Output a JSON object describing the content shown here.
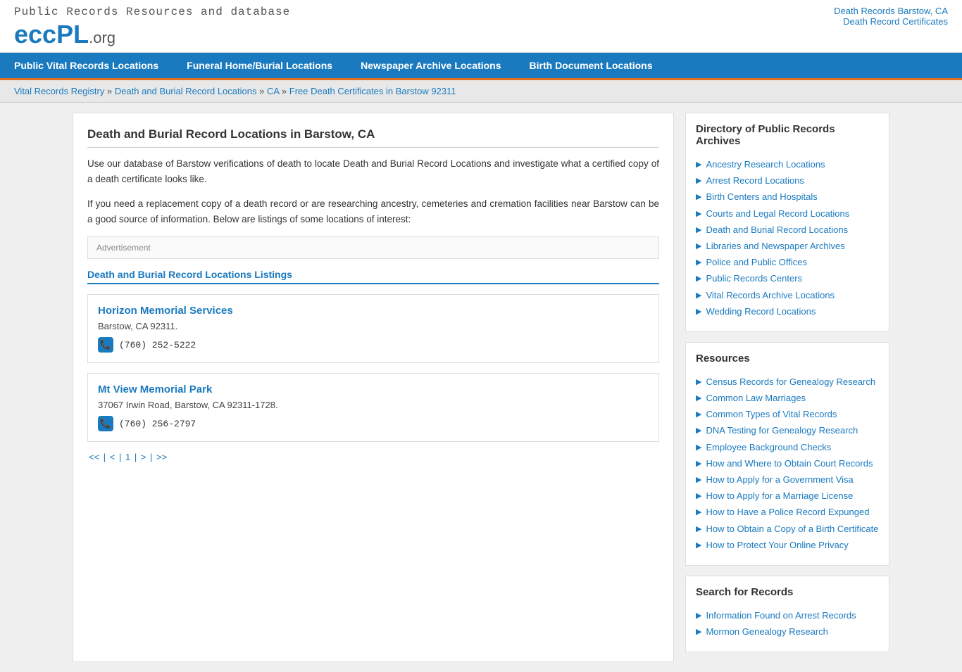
{
  "topLinks": [
    {
      "label": "Death Records Barstow, CA",
      "href": "#"
    },
    {
      "label": "Death Record Certificates",
      "href": "#"
    }
  ],
  "logo": {
    "tagline": "Public Records Resources and database",
    "eccPL": "eccPL",
    "org": ".org"
  },
  "nav": [
    {
      "label": "Public Vital Records Locations",
      "href": "#"
    },
    {
      "label": "Funeral Home/Burial Locations",
      "href": "#"
    },
    {
      "label": "Newspaper Archive Locations",
      "href": "#"
    },
    {
      "label": "Birth Document Locations",
      "href": "#"
    }
  ],
  "breadcrumb": [
    {
      "label": "Vital Records Registry",
      "href": "#"
    },
    {
      "label": "Death and Burial Record Locations",
      "href": "#"
    },
    {
      "label": "CA",
      "href": "#"
    },
    {
      "label": "Free Death Certificates in Barstow 92311",
      "href": "#"
    }
  ],
  "mainContent": {
    "title": "Death and Burial Record Locations in Barstow, CA",
    "paragraphs": [
      "Use our database of Barstow verifications of death to locate Death and Burial Record Locations and investigate what a certified copy of a death certificate looks like.",
      "If you need a replacement copy of a death record or are researching ancestry, cemeteries and cremation facilities near Barstow can be a good source of information. Below are listings of some locations of interest:"
    ],
    "adLabel": "Advertisement",
    "listingsHeading": "Death and Burial Record Locations Listings",
    "listings": [
      {
        "name": "Horizon Memorial Services",
        "address": "Barstow, CA 92311.",
        "phone": "(760) 252-5222"
      },
      {
        "name": "Mt View Memorial Park",
        "address": "37067 Irwin Road, Barstow, CA 92311-1728.",
        "phone": "(760) 256-2797"
      }
    ],
    "pagination": {
      "text": "<< | < | 1 | > | >>"
    }
  },
  "sidebar": {
    "directory": {
      "heading": "Directory of Public Records Archives",
      "items": [
        {
          "label": "Ancestry Research Locations",
          "href": "#"
        },
        {
          "label": "Arrest Record Locations",
          "href": "#"
        },
        {
          "label": "Birth Centers and Hospitals",
          "href": "#"
        },
        {
          "label": "Courts and Legal Record Locations",
          "href": "#"
        },
        {
          "label": "Death and Burial Record Locations",
          "href": "#"
        },
        {
          "label": "Libraries and Newspaper Archives",
          "href": "#"
        },
        {
          "label": "Police and Public Offices",
          "href": "#"
        },
        {
          "label": "Public Records Centers",
          "href": "#"
        },
        {
          "label": "Vital Records Archive Locations",
          "href": "#"
        },
        {
          "label": "Wedding Record Locations",
          "href": "#"
        }
      ]
    },
    "resources": {
      "heading": "Resources",
      "items": [
        {
          "label": "Census Records for Genealogy Research",
          "href": "#"
        },
        {
          "label": "Common Law Marriages",
          "href": "#"
        },
        {
          "label": "Common Types of Vital Records",
          "href": "#"
        },
        {
          "label": "DNA Testing for Genealogy Research",
          "href": "#"
        },
        {
          "label": "Employee Background Checks",
          "href": "#"
        },
        {
          "label": "How and Where to Obtain Court Records",
          "href": "#"
        },
        {
          "label": "How to Apply for a Government Visa",
          "href": "#"
        },
        {
          "label": "How to Apply for a Marriage License",
          "href": "#"
        },
        {
          "label": "How to Have a Police Record Expunged",
          "href": "#"
        },
        {
          "label": "How to Obtain a Copy of a Birth Certificate",
          "href": "#"
        },
        {
          "label": "How to Protect Your Online Privacy",
          "href": "#"
        }
      ]
    },
    "search": {
      "heading": "Search for Records",
      "items": [
        {
          "label": "Information Found on Arrest Records",
          "href": "#"
        },
        {
          "label": "Mormon Genealogy Research",
          "href": "#"
        }
      ]
    }
  }
}
